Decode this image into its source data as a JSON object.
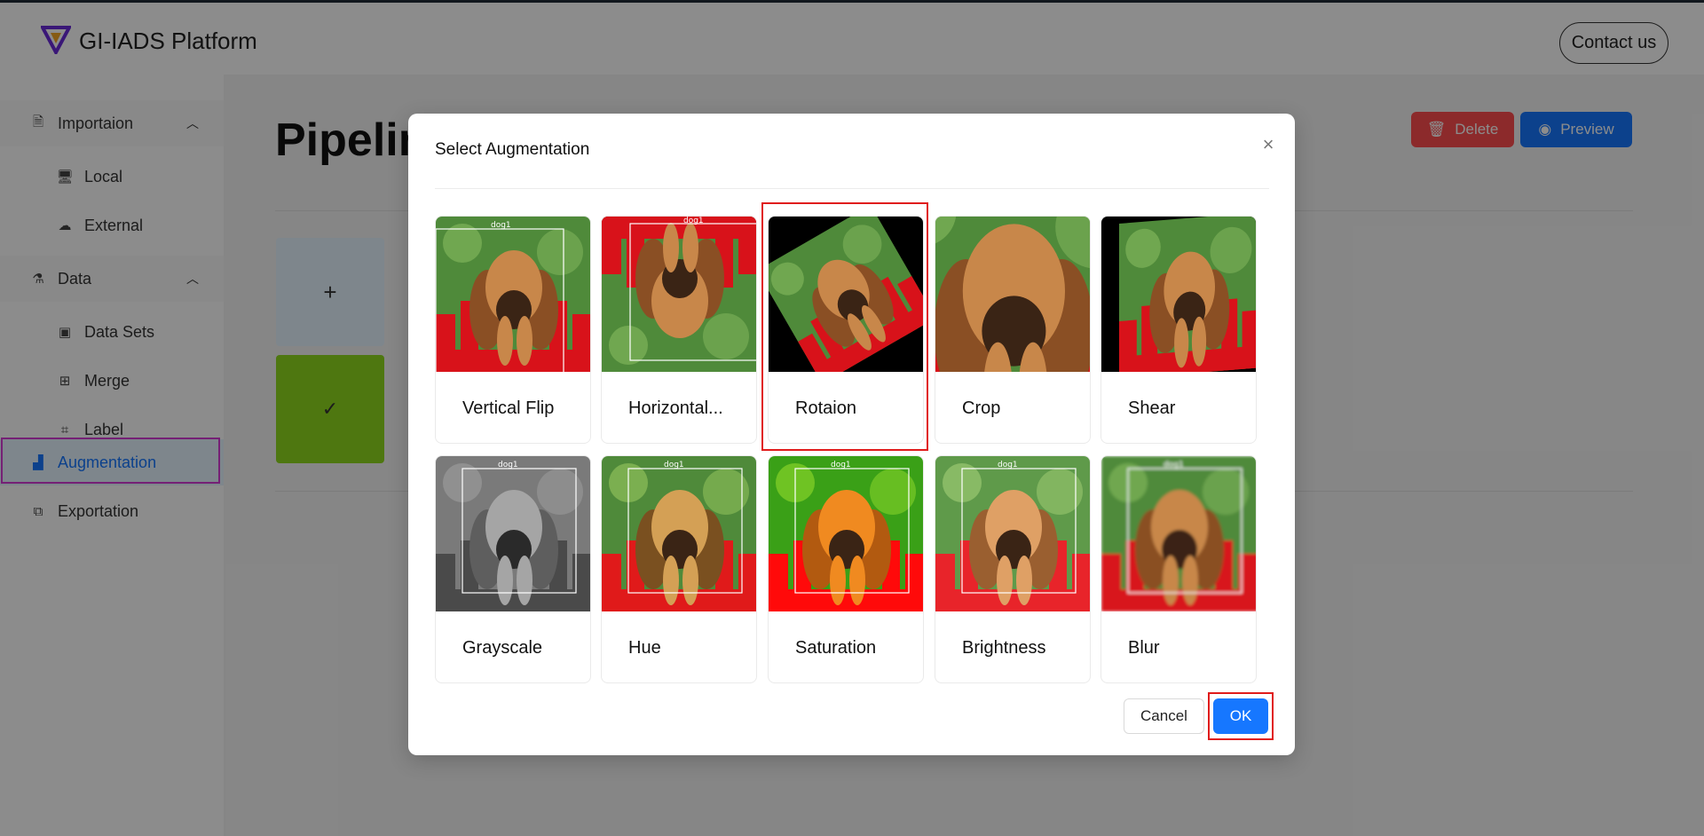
{
  "app": {
    "brand": "GI-IADS Platform",
    "contact_label": "Contact us"
  },
  "sidebar": {
    "items": [
      {
        "label": "Importaion",
        "icon": "file-import-icon",
        "kind": "group",
        "expanded": true
      },
      {
        "label": "Local",
        "icon": "desktop-icon",
        "kind": "sub"
      },
      {
        "label": "External",
        "icon": "cloud-upload-icon",
        "kind": "sub"
      },
      {
        "label": "Data",
        "icon": "flask-icon",
        "kind": "group",
        "expanded": true
      },
      {
        "label": "Data Sets",
        "icon": "database-icon",
        "kind": "sub"
      },
      {
        "label": "Merge",
        "icon": "merge-icon",
        "kind": "sub"
      },
      {
        "label": "Label",
        "icon": "label-icon",
        "kind": "sub"
      },
      {
        "label": "Augmentation",
        "icon": "chart-icon",
        "kind": "group",
        "active": true
      },
      {
        "label": "Exportation",
        "icon": "hierarchy-icon",
        "kind": "group"
      }
    ]
  },
  "main": {
    "title_partial": "Pipelin",
    "delete_label": "Delete",
    "preview_label": "Preview",
    "add_step_symbol": "+",
    "done_step_symbol": "✓"
  },
  "modal": {
    "title": "Select Augmentation",
    "close_symbol": "×",
    "options": [
      {
        "label": "Vertical Flip",
        "variant": "bbox"
      },
      {
        "label": "Horizontal...",
        "variant": "flip"
      },
      {
        "label": "Rotaion",
        "variant": "rotate",
        "selected": true
      },
      {
        "label": "Crop",
        "variant": "crop"
      },
      {
        "label": "Shear",
        "variant": "shear"
      },
      {
        "label": "Grayscale",
        "variant": "gray"
      },
      {
        "label": "Hue",
        "variant": "hue"
      },
      {
        "label": "Saturation",
        "variant": "saturation"
      },
      {
        "label": "Brightness",
        "variant": "brightness"
      },
      {
        "label": "Blur",
        "variant": "blur"
      }
    ],
    "bbox_label": "dog1",
    "cancel_label": "Cancel",
    "ok_label": "OK"
  },
  "colors": {
    "primary": "#1677ff",
    "danger": "#ff4d4f",
    "success": "#8fd91e",
    "highlight": "#e01b1b",
    "active_outline": "#d63bd6"
  }
}
